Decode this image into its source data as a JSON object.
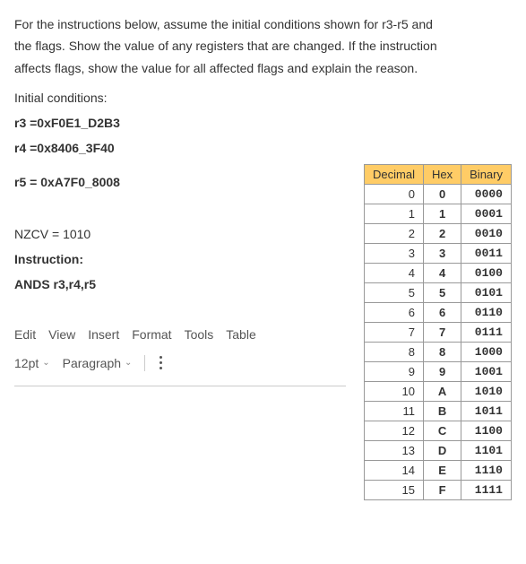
{
  "question": {
    "line1": "For the instructions below, assume the initial conditions shown for r3-r5 and",
    "line2": "the flags. Show the value of any registers that are changed. If the instruction",
    "line3": "affects flags, show the value for all affected flags and explain the reason."
  },
  "labels": {
    "initial_conditions": "Initial conditions:",
    "r3": "r3 =0xF0E1_D2B3",
    "r4": "r4 =0x8406_3F40",
    "r5": "r5 = 0xA7F0_8008",
    "nzcv": "NZCV = 1010",
    "instruction_label": "Instruction:",
    "instruction": "ANDS r3,r4,r5"
  },
  "table": {
    "headers": {
      "dec": "Decimal",
      "hex": "Hex",
      "bin": "Binary"
    },
    "rows": [
      {
        "dec": "0",
        "hex": "0",
        "bin": "0000"
      },
      {
        "dec": "1",
        "hex": "1",
        "bin": "0001"
      },
      {
        "dec": "2",
        "hex": "2",
        "bin": "0010"
      },
      {
        "dec": "3",
        "hex": "3",
        "bin": "0011"
      },
      {
        "dec": "4",
        "hex": "4",
        "bin": "0100"
      },
      {
        "dec": "5",
        "hex": "5",
        "bin": "0101"
      },
      {
        "dec": "6",
        "hex": "6",
        "bin": "0110"
      },
      {
        "dec": "7",
        "hex": "7",
        "bin": "0111"
      },
      {
        "dec": "8",
        "hex": "8",
        "bin": "1000"
      },
      {
        "dec": "9",
        "hex": "9",
        "bin": "1001"
      },
      {
        "dec": "10",
        "hex": "A",
        "bin": "1010"
      },
      {
        "dec": "11",
        "hex": "B",
        "bin": "1011"
      },
      {
        "dec": "12",
        "hex": "C",
        "bin": "1100"
      },
      {
        "dec": "13",
        "hex": "D",
        "bin": "1101"
      },
      {
        "dec": "14",
        "hex": "E",
        "bin": "1110"
      },
      {
        "dec": "15",
        "hex": "F",
        "bin": "1111"
      }
    ]
  },
  "editor": {
    "menu": {
      "edit": "Edit",
      "view": "View",
      "insert": "Insert",
      "format": "Format",
      "tools": "Tools",
      "table": "Table"
    },
    "controls": {
      "fontsize": "12pt",
      "paragraph": "Paragraph"
    }
  }
}
